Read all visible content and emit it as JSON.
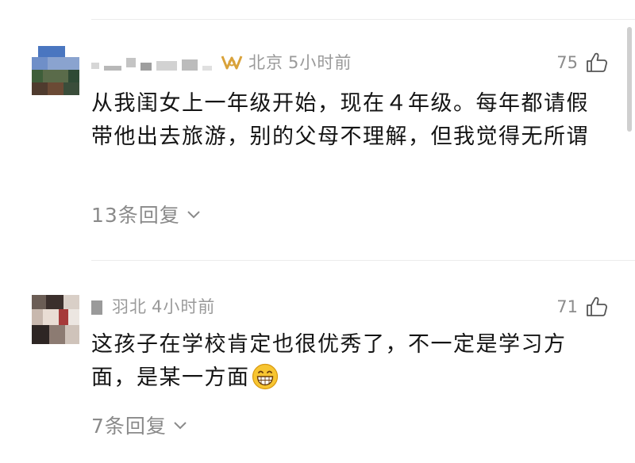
{
  "comments": [
    {
      "location": "北京",
      "time": "5小时前",
      "likes": "75",
      "text": "从我闺女上一年级开始，现在４年级。每年都请假带他出去旅游，别的父母不理解，但我觉得无所谓",
      "replies": "13条回复",
      "badge_icon": "vip-badge-icon",
      "like_icon": "thumbs-up-icon"
    },
    {
      "username_partial": "羽北",
      "time": "4小时前",
      "likes": "71",
      "text": "这孩子在学校肯定也很优秀了，不一定是学习方面，是某一方面",
      "emoji": "grinning-face-emoji",
      "replies": "7条回复",
      "like_icon": "thumbs-up-icon"
    }
  ],
  "colors": {
    "meta_gray": "#9a9a9a",
    "badge_gold": "#d9a23a",
    "text": "#141414",
    "divider": "#ececec"
  }
}
